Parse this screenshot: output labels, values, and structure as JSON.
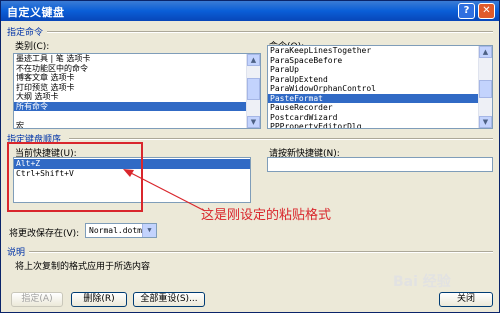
{
  "window": {
    "title": "自定义键盘"
  },
  "title_buttons": {
    "help": "?",
    "close": "✕"
  },
  "specify_command": {
    "group_label": "指定命令",
    "categories_label": "类别(C):",
    "categories": [
      "墨迹工具 | 笔 选项卡",
      "不在功能区中的命令",
      "博客文章 选项卡",
      "打印预览 选项卡",
      "大纲 选项卡",
      "所有命令",
      "",
      "宏"
    ],
    "categories_selected_index": 5,
    "commands_label": "命令(O):",
    "commands": [
      "ParaKeepLinesTogether",
      "ParaSpaceBefore",
      "ParaUp",
      "ParaUpExtend",
      "ParaWidowOrphanControl",
      "PasteFormat",
      "PauseRecorder",
      "PostcardWizard",
      "PPPropertyEditorDlg"
    ],
    "commands_selected_index": 5
  },
  "key_sequence": {
    "group_label": "指定键盘顺序",
    "current_keys_label": "当前快捷键(U):",
    "current_keys": [
      "Alt+Z",
      "Ctrl+Shift+V"
    ],
    "current_selected_index": 0,
    "new_key_label": "请按新快捷键(N):",
    "new_key_value": ""
  },
  "annotation": {
    "text": "这是刚设定的粘贴格式"
  },
  "save_in": {
    "label": "将更改保存在(V):",
    "value": "Normal.dotm"
  },
  "description": {
    "group_label": "说明",
    "text": "将上次复制的格式应用于所选内容"
  },
  "buttons": {
    "assign": "指定(A)",
    "remove": "删除(R)",
    "reset_all": "全部重设(S)...",
    "close": "关闭"
  },
  "watermark": "Bai 经验",
  "colors": {
    "annotation_red": "#d9262c",
    "selection_blue": "#316ac5",
    "group_label_blue": "#0033a8",
    "title_bar_blue": "#0a5ed7"
  }
}
